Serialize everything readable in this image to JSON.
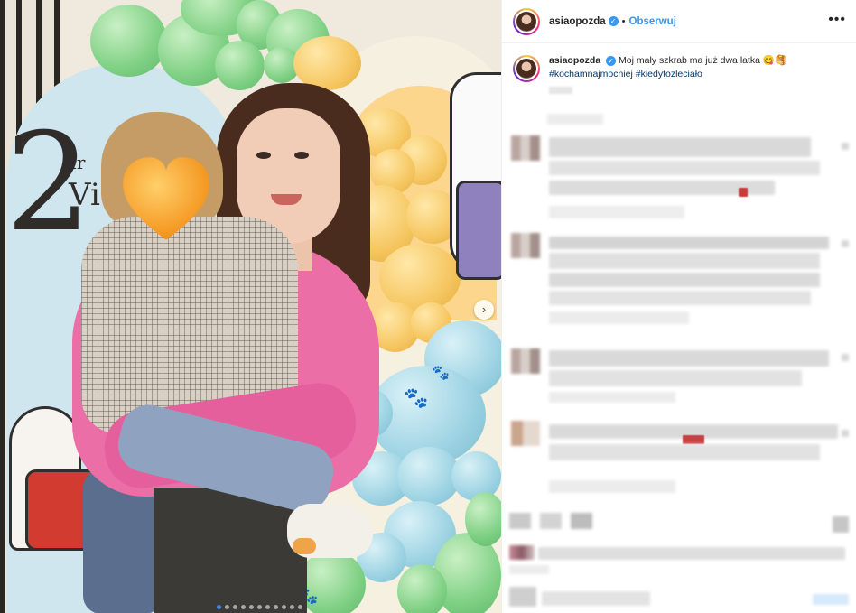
{
  "post": {
    "author": "asiaopozda",
    "verified": true,
    "separator": "•",
    "follow_label": "Obserwuj",
    "more_label": "•••",
    "caption": "Moj mały szkrab ma już dwa latka 😋🥞",
    "hashtags": [
      "#kochamnajmocniej",
      "#kiedytozleciało"
    ]
  },
  "photo": {
    "backdrop_number": "2",
    "backdrop_line1": "ur",
    "backdrop_line2": "Vi",
    "carousel_next": "›",
    "slide_count": 11,
    "active_slide": 0
  },
  "colors": {
    "link": "#3897f0",
    "hashtag": "#00376b",
    "verified_badge": "#3897f0",
    "sweater": "#ec6ea7",
    "heart_emoji": "#f7a21b"
  },
  "icons": {
    "verified": "verified-badge-icon",
    "more": "more-options-icon",
    "next": "chevron-right-icon",
    "heart": "orange-heart-icon"
  }
}
